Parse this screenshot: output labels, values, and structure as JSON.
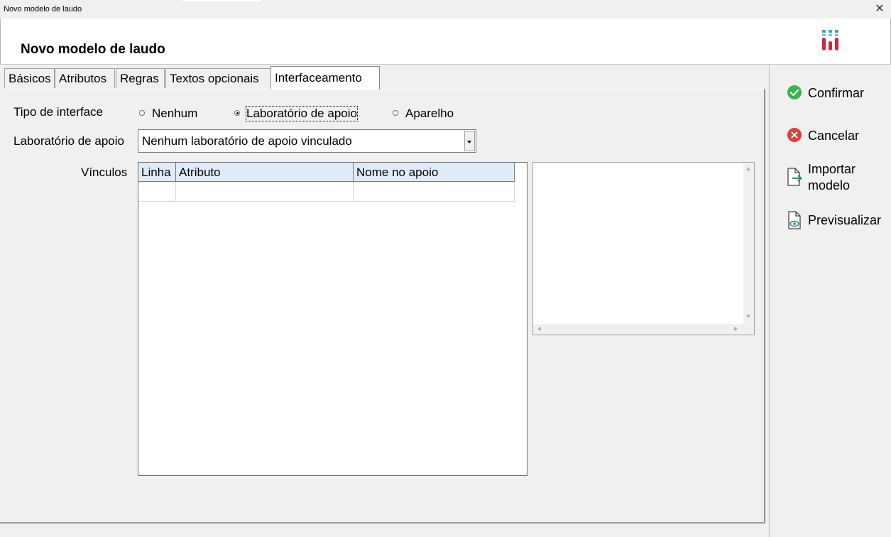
{
  "window": {
    "title": "Novo modelo de laudo",
    "close_glyph": "✕"
  },
  "header": {
    "title": "Novo modelo de laudo",
    "logo_icon": "lab-tubes-logo"
  },
  "tabs": [
    {
      "label": "Básicos"
    },
    {
      "label": "Atributos"
    },
    {
      "label": "Regras"
    },
    {
      "label": "Textos opcionais"
    },
    {
      "label": "Interfaceamento",
      "active": true
    }
  ],
  "interface_type": {
    "label": "Tipo de interface",
    "options": [
      {
        "label": "Nenhum",
        "checked": false
      },
      {
        "label": "Laboratório de apoio",
        "checked": true
      },
      {
        "label": "Aparelho",
        "checked": false
      }
    ]
  },
  "support_lab": {
    "label": "Laboratório de apoio",
    "value": "Nenhum laboratório de apoio vinculado"
  },
  "links": {
    "label": "Vínculos",
    "columns": [
      "Linha",
      "Atributo",
      "Nome no apoio"
    ],
    "rows": [
      [
        "",
        "",
        ""
      ]
    ]
  },
  "actions": {
    "confirm": "Confirmar",
    "cancel": "Cancelar",
    "import_line1": "Importar",
    "import_line2": "modelo",
    "preview": "Previsualizar"
  },
  "colors": {
    "confirm_green": "#3cb44b",
    "cancel_red": "#e03c3c",
    "grid_header_bg": "#e0ebfa",
    "icon_teal": "#2a8c8c"
  }
}
